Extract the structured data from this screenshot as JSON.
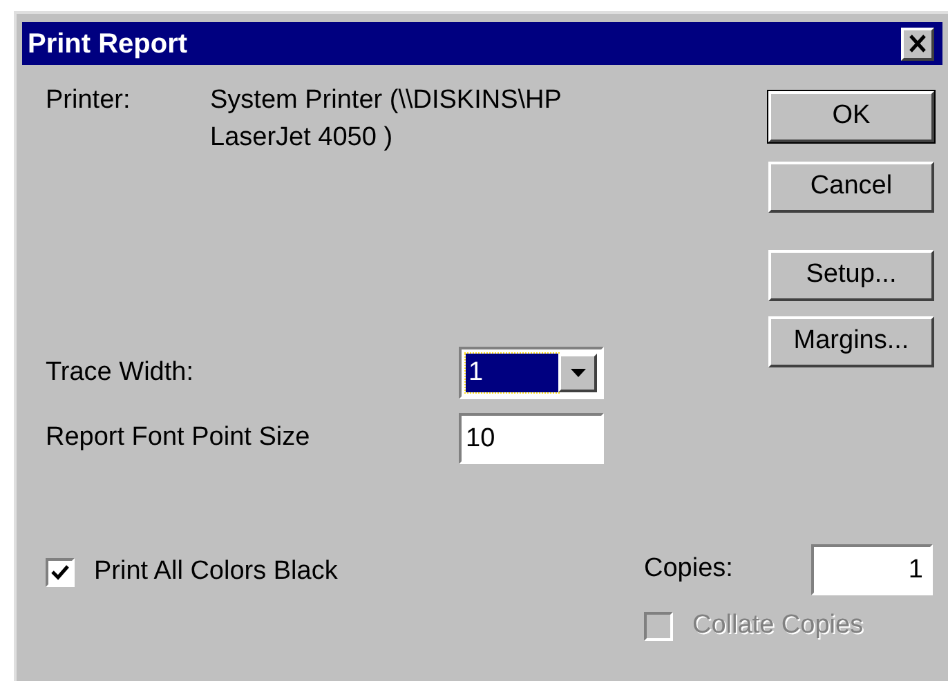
{
  "window": {
    "title": "Print Report"
  },
  "printer": {
    "label": "Printer:",
    "value": "System Printer (\\\\DISKINS\\HP LaserJet 4050 )"
  },
  "buttons": [
    {
      "label": "OK",
      "default": true
    },
    {
      "label": "Cancel",
      "default": false
    },
    {
      "label": "Setup...",
      "default": false
    },
    {
      "label": "Margins...",
      "default": false
    }
  ],
  "trace_width": {
    "label": "Trace Width:",
    "value": "1",
    "focused": true
  },
  "font_size": {
    "label": "Report Font Point Size",
    "value": "10"
  },
  "print_black": {
    "label": "Print All Colors Black",
    "checked": true,
    "disabled": false
  },
  "copies": {
    "label": "Copies:",
    "value": "1"
  },
  "collate": {
    "label": "Collate Copies",
    "checked": false,
    "disabled": true
  }
}
